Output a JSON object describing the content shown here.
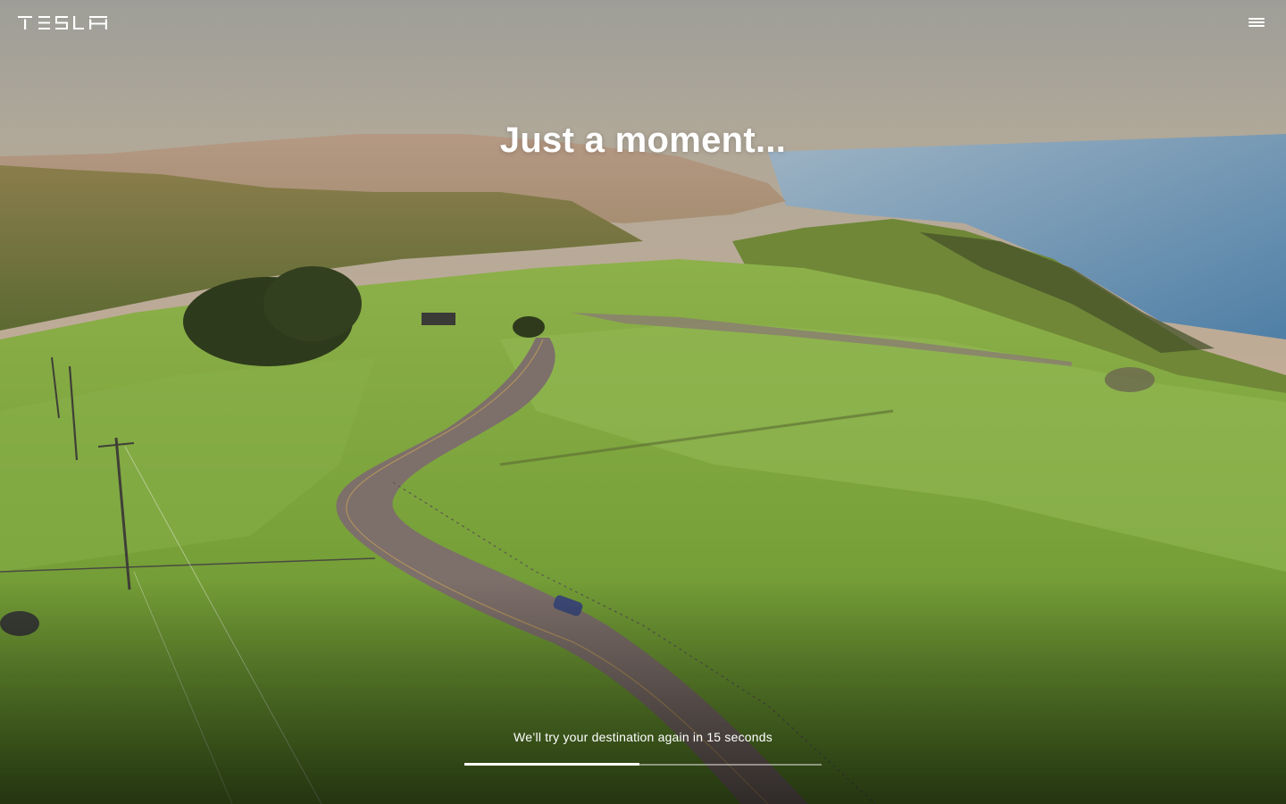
{
  "header": {
    "logo_text": "TESLA",
    "menu_icon": "hamburger-menu-icon"
  },
  "main": {
    "headline": "Just a moment...",
    "retry_message": "We’ll try your destination again in 15 seconds",
    "progress": {
      "fraction_complete": 0.49
    }
  },
  "colors": {
    "text": "#ffffff"
  }
}
